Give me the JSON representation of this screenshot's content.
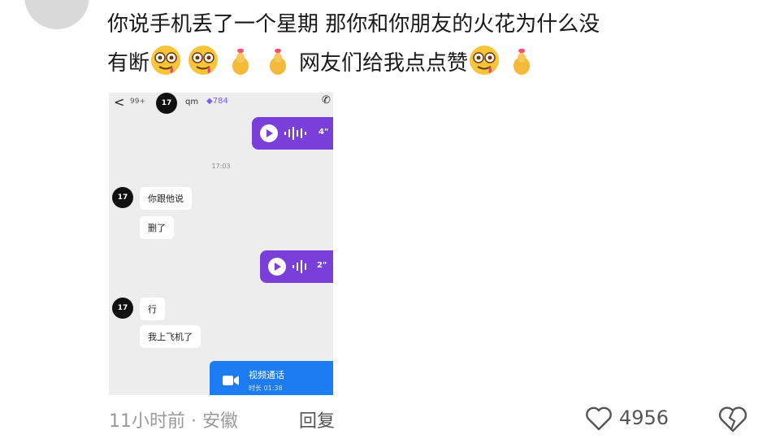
{
  "comment": {
    "line1": "你说手机丢了一个星期 那你和你朋友的火花为什么没",
    "line2_a": "有断",
    "line2_b": "网友们给我点点赞"
  },
  "screenshot": {
    "back": "<",
    "badge": "99+",
    "avatar_label": "17",
    "contact_name": "qm",
    "gem_count": "784",
    "voice1_duration": "4\"",
    "time": "17:03",
    "msg1": "你跟他说",
    "msg2": "删了",
    "voice2_duration": "2\"",
    "msg3": "行",
    "msg4": "我上飞机了",
    "video_title": "视频通话",
    "video_sub": "时长 01:38"
  },
  "footer": {
    "meta": "11小时前 · 安徽",
    "reply": "回复",
    "likes": "4956"
  },
  "colors": {
    "voice_bubble": "#7b3fd9",
    "video_bubble": "#1e7cf2"
  }
}
